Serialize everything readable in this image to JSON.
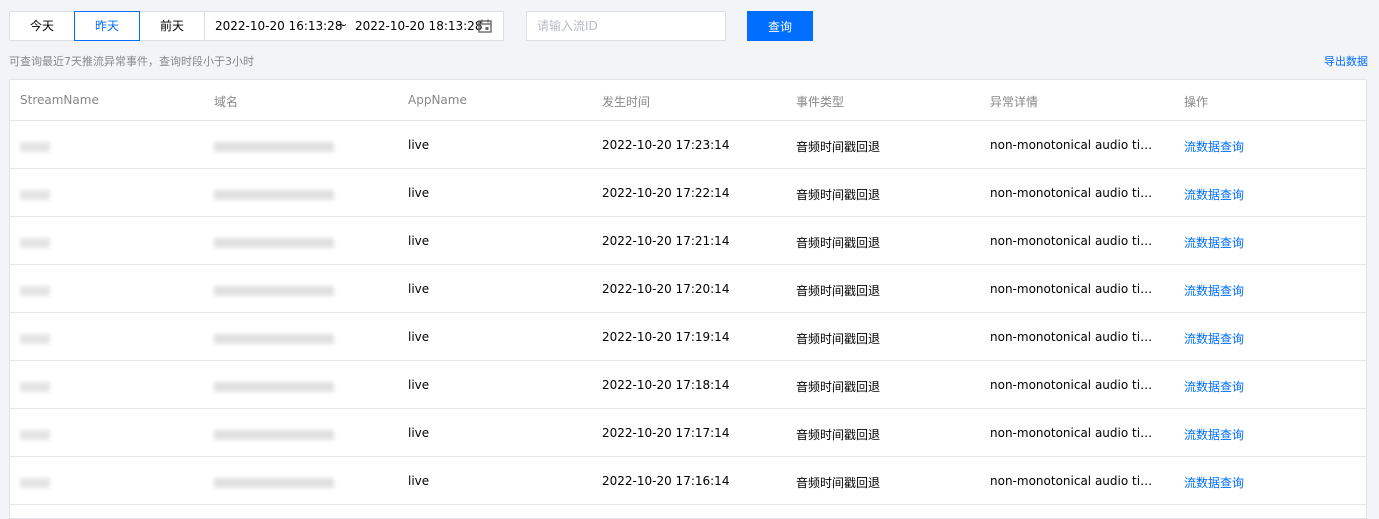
{
  "toolbar": {
    "days": [
      {
        "label": "今天",
        "active": false
      },
      {
        "label": "昨天",
        "active": true
      },
      {
        "label": "前天",
        "active": false
      }
    ],
    "start_time": "2022-10-20 16:13:28",
    "separator": "~",
    "end_time": "2022-10-20 18:13:28",
    "calendar_icon": "calendar-icon",
    "stream_placeholder": "请输入流ID",
    "query_label": "查询"
  },
  "hint": "可查询最近7天推流异常事件，查询时段小于3小时",
  "export_label": "导出数据",
  "colors": {
    "accent": "#006eff",
    "border": "#dcdfe5",
    "background": "#f3f4f7"
  },
  "table": {
    "headers": [
      "StreamName",
      "域名",
      "AppName",
      "发生时间",
      "事件类型",
      "异常详情",
      "操作"
    ],
    "rows": [
      {
        "app": "live",
        "time": "2022-10-20 17:23:14",
        "type": "音频时间戳回退",
        "detail": "non-monotonical audio timest...",
        "action": "流数据查询"
      },
      {
        "app": "live",
        "time": "2022-10-20 17:22:14",
        "type": "音频时间戳回退",
        "detail": "non-monotonical audio timest...",
        "action": "流数据查询"
      },
      {
        "app": "live",
        "time": "2022-10-20 17:21:14",
        "type": "音频时间戳回退",
        "detail": "non-monotonical audio timest...",
        "action": "流数据查询"
      },
      {
        "app": "live",
        "time": "2022-10-20 17:20:14",
        "type": "音频时间戳回退",
        "detail": "non-monotonical audio timest...",
        "action": "流数据查询"
      },
      {
        "app": "live",
        "time": "2022-10-20 17:19:14",
        "type": "音频时间戳回退",
        "detail": "non-monotonical audio timest...",
        "action": "流数据查询"
      },
      {
        "app": "live",
        "time": "2022-10-20 17:18:14",
        "type": "音频时间戳回退",
        "detail": "non-monotonical audio timest...",
        "action": "流数据查询"
      },
      {
        "app": "live",
        "time": "2022-10-20 17:17:14",
        "type": "音频时间戳回退",
        "detail": "non-monotonical audio timest...",
        "action": "流数据查询"
      },
      {
        "app": "live",
        "time": "2022-10-20 17:16:14",
        "type": "音频时间戳回退",
        "detail": "non-monotonical audio timest...",
        "action": "流数据查询"
      }
    ]
  }
}
